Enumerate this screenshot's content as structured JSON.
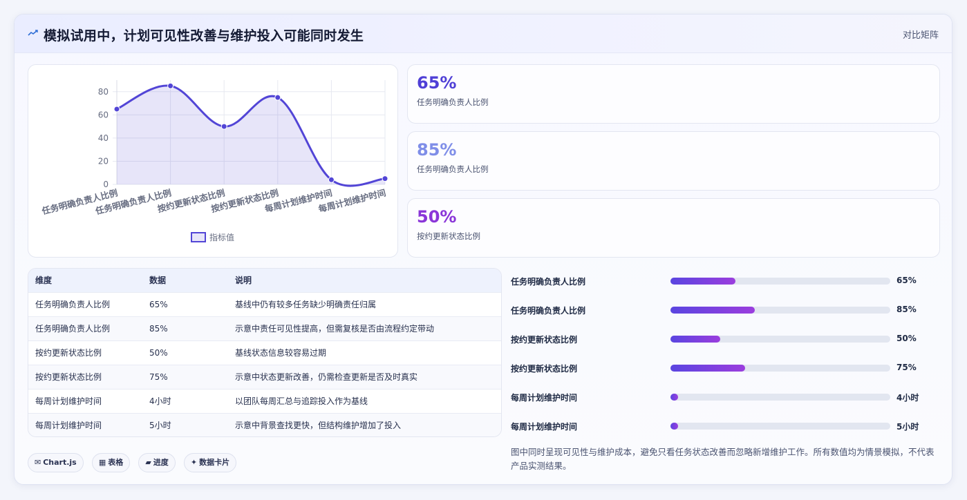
{
  "header": {
    "icon": "trend-icon",
    "title": "模拟试用中，计划可见性改善与维护投入可能同时发生",
    "action_label": "对比矩阵"
  },
  "stats": [
    {
      "value": "65%",
      "label": "任务明确负责人比例",
      "color": "#4f3fd6"
    },
    {
      "value": "85%",
      "label": "任务明确负责人比例",
      "color": "#7f8ee8"
    },
    {
      "value": "50%",
      "label": "按约更新状态比例",
      "color": "#8a35d8"
    }
  ],
  "table": {
    "headers": [
      "维度",
      "数据",
      "说明"
    ],
    "rows": [
      [
        "任务明确负责人比例",
        "65%",
        "基线中仍有较多任务缺少明确责任归属"
      ],
      [
        "任务明确负责人比例",
        "85%",
        "示意中责任可见性提高，但需复核是否由流程约定带动"
      ],
      [
        "按约更新状态比例",
        "50%",
        "基线状态信息较容易过期"
      ],
      [
        "按约更新状态比例",
        "75%",
        "示意中状态更新改善，仍需检查更新是否及时真实"
      ],
      [
        "每周计划维护时间",
        "4小时",
        "以团队每周汇总与追踪投入作为基线"
      ],
      [
        "每周计划维护时间",
        "5小时",
        "示意中背景查找更快，但结构维护增加了投入"
      ]
    ]
  },
  "bars": [
    {
      "label": "任务明确负责人比例",
      "value_text": "65%",
      "fraction": 0.295
    },
    {
      "label": "任务明确负责人比例",
      "value_text": "85%",
      "fraction": 0.385
    },
    {
      "label": "按约更新状态比例",
      "value_text": "50%",
      "fraction": 0.227
    },
    {
      "label": "按约更新状态比例",
      "value_text": "75%",
      "fraction": 0.34
    },
    {
      "label": "每周计划维护时间",
      "value_text": "4小时",
      "fraction": 0.036
    },
    {
      "label": "每周计划维护时间",
      "value_text": "5小时",
      "fraction": 0.036
    }
  ],
  "note": "图中同时呈现可见性与维护成本，避免只看任务状态改善而忽略新增维护工作。所有数值均为情景模拟，不代表产品实测结果。",
  "chips": [
    {
      "icon": "✉",
      "label": "Chart.js"
    },
    {
      "icon": "▦",
      "label": "表格"
    },
    {
      "icon": "▰",
      "label": "进度"
    },
    {
      "icon": "✦",
      "label": "数据卡片"
    }
  ],
  "chart_data": {
    "type": "line",
    "categories": [
      "任务明确负责人比例",
      "任务明确负责人比例",
      "按约更新状态比例",
      "按约更新状态比例",
      "每周计划维护时间",
      "每周计划维护时间"
    ],
    "series": [
      {
        "name": "指标值",
        "values": [
          65,
          85,
          50,
          75,
          4,
          5
        ],
        "color": "#5245d6"
      }
    ],
    "yticks": [
      0,
      20,
      40,
      60,
      80
    ],
    "ylim": [
      0,
      90
    ],
    "grid": true,
    "fill": true,
    "legend": "bottom"
  }
}
